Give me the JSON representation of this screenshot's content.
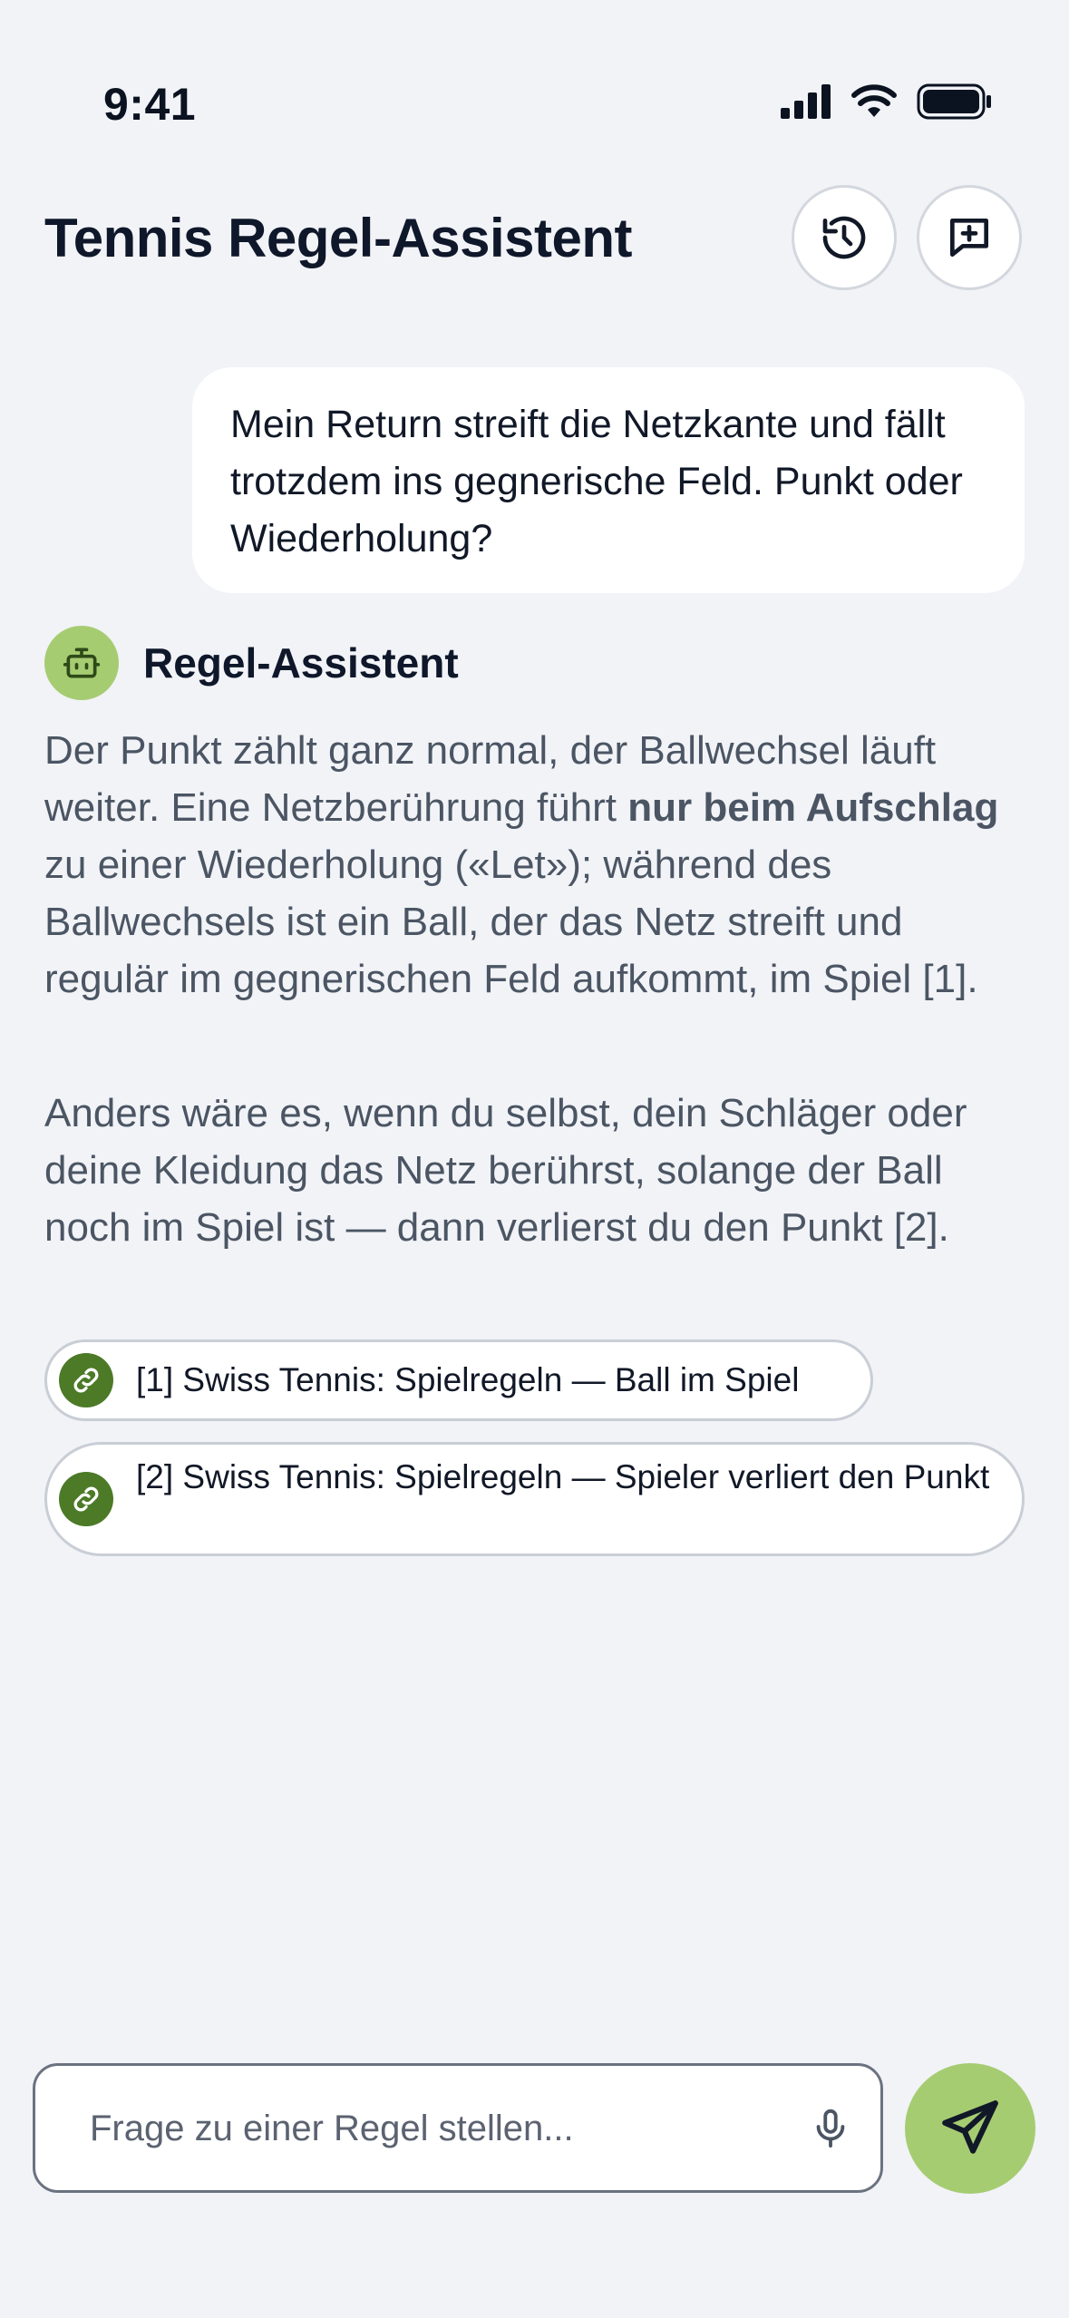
{
  "status_bar": {
    "time": "9:41"
  },
  "header": {
    "title": "Tennis Regel-Assistent"
  },
  "conversation": {
    "user_message": "Mein Return streift die Netzkante und fällt trotzdem ins gegnerische Feld. Punkt oder Wiederholung?",
    "assistant": {
      "name": "Regel-Assistent",
      "p1_a": "Der Punkt zählt ganz normal, der Ballwechsel läuft weiter. Eine Netzberührung führt ",
      "p1_bold": "nur beim Aufschlag",
      "p1_b": " zu einer Wiederholung («Let»); während des Ballwechsels ist ein Ball, der das Netz streift und regulär im gegnerischen Feld aufkommt, im Spiel [1].",
      "p2": "Anders wäre es, wenn du selbst, dein Schläger oder deine Kleidung das Netz berührst, solange der Ball noch im Spiel ist — dann verlierst du den Punkt [2].",
      "sources": [
        {
          "label": "[1] Swiss Tennis: Spielregeln — Ball im Spiel",
          "icon": "link-icon"
        },
        {
          "label": "[2] Swiss Tennis: Spielregeln — Spieler verliert den Punkt",
          "icon": "link-icon"
        }
      ]
    }
  },
  "composer": {
    "placeholder": "Frage zu einer Regel stellen..."
  },
  "colors": {
    "accent": "#A6CC72",
    "link_chip": "#4C7A27",
    "background": "#F1F3F7"
  }
}
